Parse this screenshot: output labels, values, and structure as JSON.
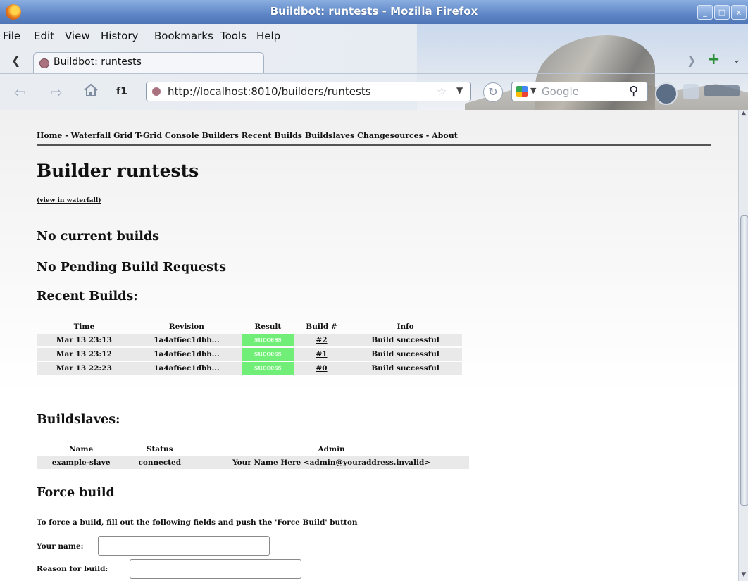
{
  "window": {
    "title": "Buildbot: runtests - Mozilla Firefox",
    "buttons": [
      "_",
      "□",
      "x"
    ]
  },
  "menu": [
    "File",
    "Edit",
    "View",
    "History",
    "Bookmarks",
    "Tools",
    "Help"
  ],
  "tab": {
    "title": "Buildbot: runtests"
  },
  "toolbar": {
    "back_icon": "back-arrow-icon",
    "forward_icon": "forward-arrow-icon",
    "home_icon": "home-icon",
    "shortcut": "f1",
    "url": "http://localhost:8010/builders/runtests",
    "search_placeholder": "Google"
  },
  "page": {
    "nav": {
      "home": "Home",
      "sep1": "-",
      "links": [
        "Waterfall",
        "Grid",
        "T-Grid",
        "Console",
        "Builders",
        "Recent Builds",
        "Buildslaves",
        "Changesources"
      ],
      "sep2": "-",
      "about": "About"
    },
    "title": "Builder runtests",
    "view_in_waterfall": "(view in waterfall)",
    "no_current": "No current builds",
    "no_pending": "No Pending Build Requests",
    "recent_heading": "Recent Builds:",
    "recent_columns": [
      "Time",
      "Revision",
      "Result",
      "Build #",
      "Info"
    ],
    "recent_rows": [
      {
        "time": "Mar 13 23:13",
        "revision": "1a4af6ec1dbb...",
        "result": "success",
        "build": "#2",
        "info": "Build successful"
      },
      {
        "time": "Mar 13 23:12",
        "revision": "1a4af6ec1dbb...",
        "result": "success",
        "build": "#1",
        "info": "Build successful"
      },
      {
        "time": "Mar 13 22:23",
        "revision": "1a4af6ec1dbb...",
        "result": "success",
        "build": "#0",
        "info": "Build successful"
      }
    ],
    "slaves_heading": "Buildslaves:",
    "slave_columns": [
      "Name",
      "Status",
      "Admin"
    ],
    "slaves": [
      {
        "name": "example-slave",
        "status": "connected",
        "admin": "Your Name Here <admin@youraddress.invalid>"
      }
    ],
    "force_heading": "Force build",
    "force_desc": "To force a build, fill out the following fields and push the 'Force Build' button",
    "form": {
      "your_name": "Your name:",
      "reason": "Reason for build:"
    }
  },
  "colors": {
    "success": "#71ee77",
    "titlebar": "#5e86c6"
  }
}
